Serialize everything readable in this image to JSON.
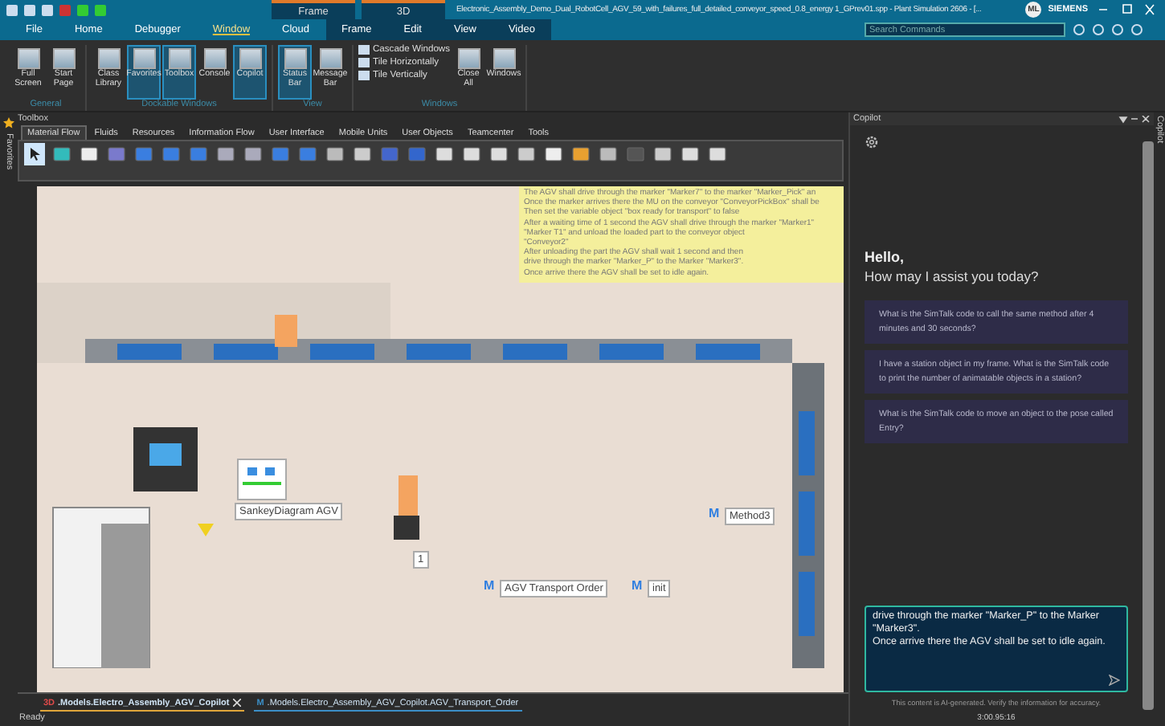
{
  "title_bar": {
    "context_headers": [
      "Frame",
      "3D"
    ],
    "title": "Electronic_Assembly_Demo_Dual_RobotCell_AGV_59_with_failures_full_detailed_conveyor_speed_0.8_energy 1_GPrev01.spp - Plant Simulation 2606 - [...",
    "avatar": "ML",
    "brand": "SIEMENS"
  },
  "menu": [
    {
      "label": "File",
      "selected": false
    },
    {
      "label": "Home",
      "selected": false
    },
    {
      "label": "Debugger",
      "selected": false
    },
    {
      "label": "Window",
      "selected": true
    },
    {
      "label": "Cloud",
      "selected": false
    },
    {
      "label": "Frame",
      "selected": false
    },
    {
      "label": "Edit",
      "selected": false
    },
    {
      "label": "View",
      "selected": false
    },
    {
      "label": "Video",
      "selected": false
    }
  ],
  "search": {
    "placeholder": "Search Commands"
  },
  "ribbon": [
    {
      "label": "General",
      "buttons": [
        {
          "label": "Full Screen",
          "selected": false
        },
        {
          "label": "Start Page",
          "selected": false
        }
      ]
    },
    {
      "label": "Dockable Windows",
      "buttons": [
        {
          "label": "Class Library",
          "selected": false
        },
        {
          "label": "Favorites",
          "selected": true
        },
        {
          "label": "Toolbox",
          "selected": true
        },
        {
          "label": "Console",
          "selected": false
        },
        {
          "label": "Copilot",
          "selected": true
        }
      ]
    },
    {
      "label": "View",
      "buttons": [
        {
          "label": "Status Bar",
          "selected": true
        },
        {
          "label": "Message Bar",
          "selected": false
        }
      ]
    }
  ],
  "windows_group": {
    "label": "Windows",
    "items": [
      "Cascade Windows",
      "Tile Horizontally",
      "Tile Vertically"
    ],
    "buttons": [
      "Close All",
      "Windows"
    ]
  },
  "side_strip": "Favorites",
  "toolbox": {
    "title": "Toolbox",
    "tabs": [
      {
        "label": "Material Flow",
        "selected": true
      },
      {
        "label": "Fluids",
        "selected": false
      },
      {
        "label": "Resources",
        "selected": false
      },
      {
        "label": "Information Flow",
        "selected": false
      },
      {
        "label": "User Interface",
        "selected": false
      },
      {
        "label": "Mobile Units",
        "selected": false
      },
      {
        "label": "User Objects",
        "selected": false
      },
      {
        "label": "Teamcenter",
        "selected": false
      },
      {
        "label": "Tools",
        "selected": false
      }
    ],
    "tools": [
      {
        "selected": true
      },
      {
        "selected": false
      },
      {
        "selected": false
      },
      {
        "selected": false
      },
      {
        "selected": false
      },
      {
        "selected": false
      },
      {
        "selected": false
      },
      {
        "selected": false
      },
      {
        "selected": false
      },
      {
        "selected": false
      },
      {
        "selected": false
      },
      {
        "selected": false
      },
      {
        "selected": false
      },
      {
        "selected": false
      },
      {
        "selected": false
      },
      {
        "selected": false
      },
      {
        "selected": false
      },
      {
        "selected": false
      },
      {
        "selected": false
      },
      {
        "selected": false
      },
      {
        "selected": false
      },
      {
        "selected": false
      },
      {
        "selected": false
      },
      {
        "selected": false
      },
      {
        "selected": false
      },
      {
        "selected": false
      }
    ]
  },
  "scene": {
    "note": [
      "The AGV shall drive through the marker \"Marker7\" to the marker \"Marker_Pick\" an",
      "Once the marker arrives there the MU on the conveyor \"ConveyorPickBox\" shall be",
      "Then set the variable object \"box ready for transport\" to false",
      "After a waiting time of 1 second the AGV shall drive through the marker \"Marker1\"",
      "\"Marker T1\" and unload the loaded part to the conveyor object",
      "\"Conveyor2\"",
      "After unloading the part the AGV shall wait 1 second and then",
      "drive through the marker \"Marker_P\" to the Marker \"Marker3\".",
      "Once arrive there the AGV shall be set to idle again."
    ],
    "labels": [
      {
        "kind": "plain",
        "text": "SankeyDiagram AGV"
      },
      {
        "kind": "method",
        "icon": "M",
        "text": "Method3"
      },
      {
        "kind": "method",
        "icon": "M",
        "text": "AGV Transport Order"
      },
      {
        "kind": "method",
        "icon": "M",
        "text": "init"
      },
      {
        "kind": "plain",
        "text": "1"
      }
    ]
  },
  "copilot": {
    "title": "Copilot",
    "greeting": "Hello,",
    "question": "How may I assist you today?",
    "suggestions": [
      "What is the SimTalk code to call the same method after 4 minutes and 30 seconds?",
      "I have a station object in my frame. What is the SimTalk code to print the number of animatable objects in a station?",
      "What is the SimTalk code to move an object to the pose called Entry?"
    ],
    "input": {
      "value": "drive through the marker \"Marker_P\" to the Marker \"Marker3\".\nOnce arrive there the AGV shall be set to idle again."
    },
    "disclaimer": "This content is AI-generated. Verify the information for accuracy.",
    "side_tab": "Copilot"
  },
  "doc_tabs": [
    {
      "kind": "scene",
      "badge": "3D",
      "label": ".Models.Electro_Assembly_AGV_Copilot",
      "selected": true
    },
    {
      "kind": "method",
      "badge": "M",
      "label": ".Models.Electro_Assembly_AGV_Copilot.AGV_Transport_Order",
      "selected": false
    }
  ],
  "status_bar": {
    "text": "Ready",
    "time": "3:00.95:16"
  }
}
